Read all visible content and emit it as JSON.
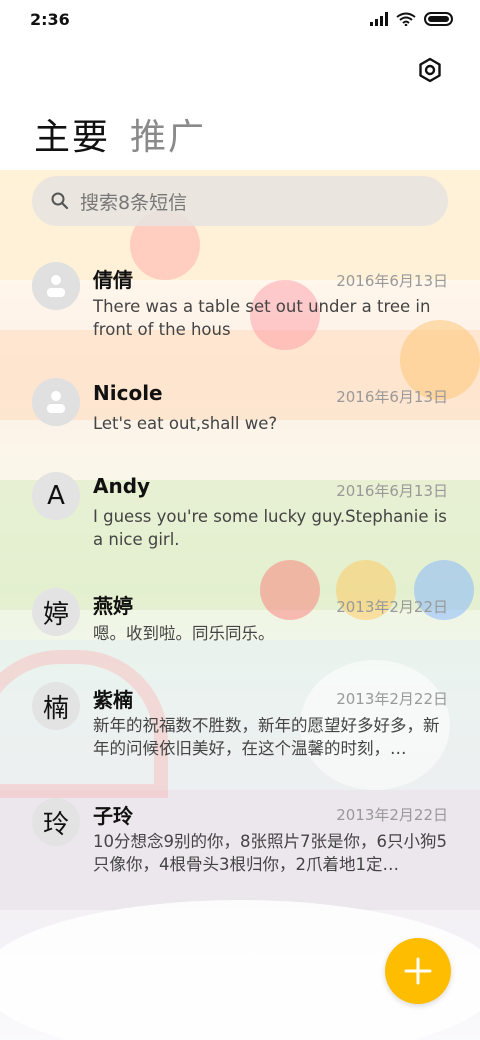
{
  "status_bar": {
    "time": "2:36"
  },
  "tabs": [
    {
      "label": "主要"
    },
    {
      "label": "推广"
    }
  ],
  "search": {
    "placeholder": "搜索8条短信"
  },
  "conversations": [
    {
      "avatar": "",
      "name": "倩倩",
      "date": "2016年6月13日",
      "preview": "There was a table set out under a tree in front of the hous"
    },
    {
      "avatar": "",
      "name": "Nicole",
      "date": "2016年6月13日",
      "preview": "Let's eat out,shall we?"
    },
    {
      "avatar": "A",
      "name": "Andy",
      "date": "2016年6月13日",
      "preview": "I guess you're some lucky guy.Stephanie is a nice girl."
    },
    {
      "avatar": "婷",
      "name": "燕婷",
      "date": "2013年2月22日",
      "preview": "嗯。收到啦。同乐同乐。"
    },
    {
      "avatar": "楠",
      "name": "紫楠",
      "date": "2013年2月22日",
      "preview": "新年的祝福数不胜数，新年的愿望好多好多，新年的问候依旧美好，在这个温馨的时刻，…"
    },
    {
      "avatar": "玲",
      "name": "子玲",
      "date": "2013年2月22日",
      "preview": "10分想念9别的你，8张照片7张是你，6只小狗5只像你，4根骨头3根归你，2爪着地1定…"
    }
  ],
  "colors": {
    "fab": "#ffbd00"
  },
  "icons": {
    "settings": "settings-icon",
    "search": "search-icon",
    "compose": "plus-icon"
  }
}
